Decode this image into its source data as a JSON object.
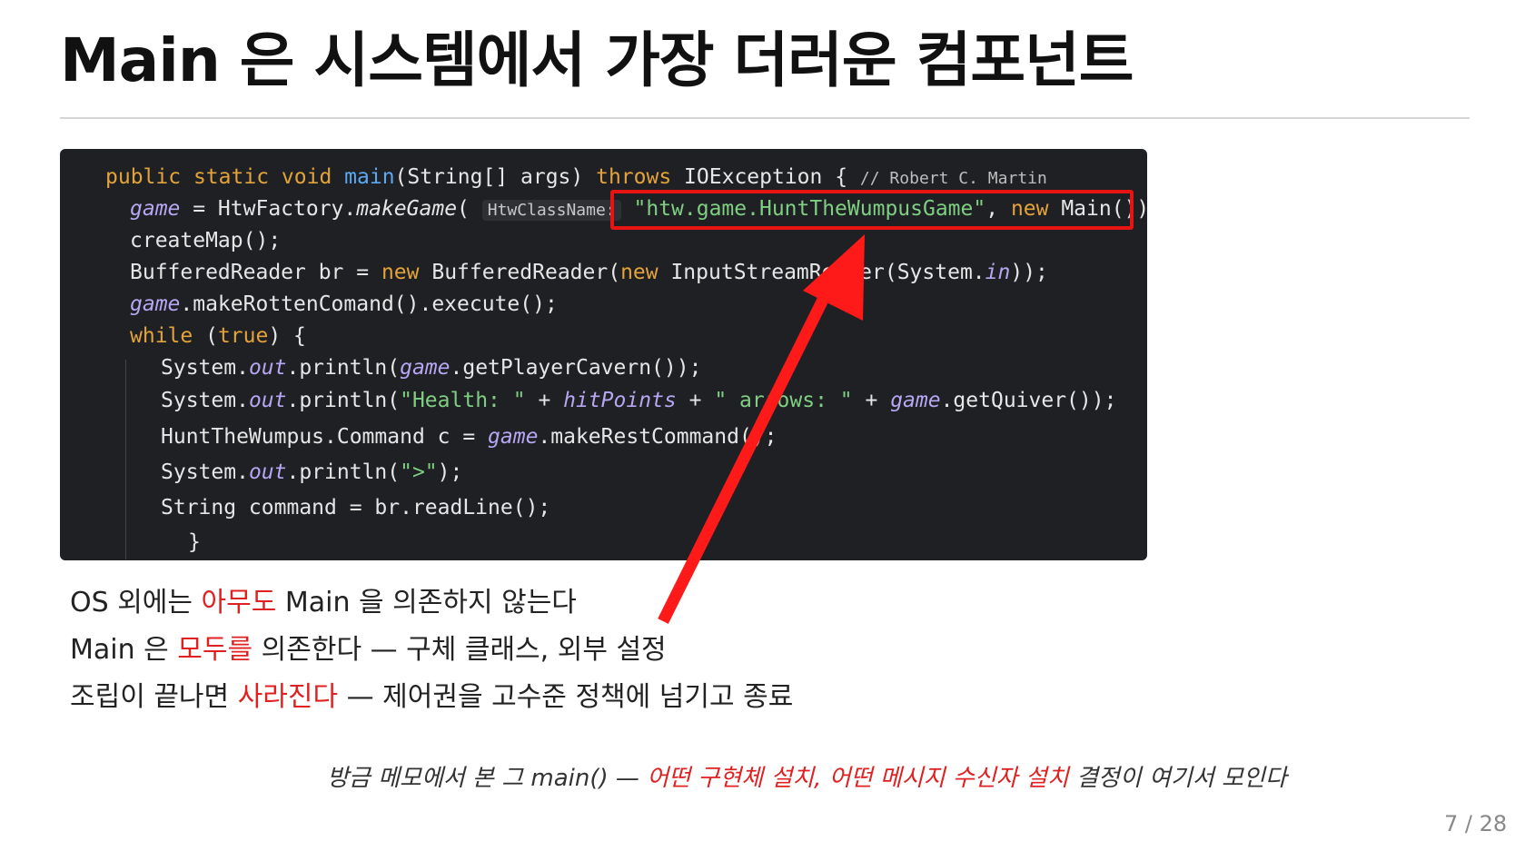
{
  "slide": {
    "title": "Main 은 시스템에서 가장 더러운 컴포넌트",
    "page_number": "7 / 28"
  },
  "code": {
    "l1_public": "public",
    "l1_static": "static",
    "l1_void": "void",
    "l1_main": "main",
    "l1_args": "(String[] args) ",
    "l1_throws": "throws",
    "l1_ioe": " IOException { ",
    "l1_comment": "// Robert C. Martin",
    "l2_game": "game",
    "l2_eq": " = HtwFactory.",
    "l2_make": "makeGame",
    "l2_paren": "( ",
    "l2_hint": "HtwClassName:",
    "l2_string": "\"htw.game.HuntTheWumpusGame\"",
    "l2_comma": ", ",
    "l2_new": "new",
    "l2_main": " Main());",
    "l3": "createMap();",
    "l4_a": "BufferedReader br = ",
    "l4_new1": "new",
    "l4_b": " BufferedReader(",
    "l4_new2": "new",
    "l4_c": " InputStreamReader(System.",
    "l4_in": "in",
    "l4_d": "));",
    "l5_game": "game",
    "l5_rest": ".makeRottenComand().execute();",
    "l6_while": "while",
    "l6_open": " (",
    "l6_true": "true",
    "l6_close": ") {",
    "l7_a": "System.",
    "l7_out": "out",
    "l7_b": ".println(",
    "l7_game": "game",
    "l7_c": ".getPlayerCavern());",
    "l8_a": "System.",
    "l8_out": "out",
    "l8_b": ".println(",
    "l8_s1": "\"Health: \"",
    "l8_plus1": " + ",
    "l8_hp": "hitPoints",
    "l8_plus2": " + ",
    "l8_s2": "\" arrows: \"",
    "l8_plus3": " + ",
    "l8_game": "game",
    "l8_c": ".getQuiver());",
    "l9_a": "HuntTheWumpus.Command c = ",
    "l9_game": "game",
    "l9_b": ".makeRestCommand();",
    "l10_a": "System.",
    "l10_out": "out",
    "l10_b": ".println(",
    "l10_s": "\">\"",
    "l10_c": ");",
    "l11": "String command = br.readLine();",
    "l12": "}"
  },
  "bullets": {
    "b1_pre": "OS 외에는 ",
    "b1_red": "아무도",
    "b1_post": " Main 을 의존하지 않는다",
    "b2_pre": "Main 은 ",
    "b2_red": "모두를",
    "b2_post": " 의존한다 — 구체 클래스, 외부 설정",
    "b3_pre": "조립이 끝나면 ",
    "b3_red": "사라진다",
    "b3_post": " — 제어권을 고수준 정책에 넘기고 종료"
  },
  "note": {
    "pre": "방금 메모에서 본 그 main() — ",
    "red": "어떤 구현체 설치, 어떤 메시지 수신자 설치",
    "post": " 결정이 여기서 모인다"
  },
  "colors": {
    "code_bg": "#1f2023",
    "keyword": "#e4a33a",
    "string": "#7fcf83",
    "field": "#b7a6f2",
    "method": "#5aa9f2",
    "highlight": "#e02121"
  }
}
